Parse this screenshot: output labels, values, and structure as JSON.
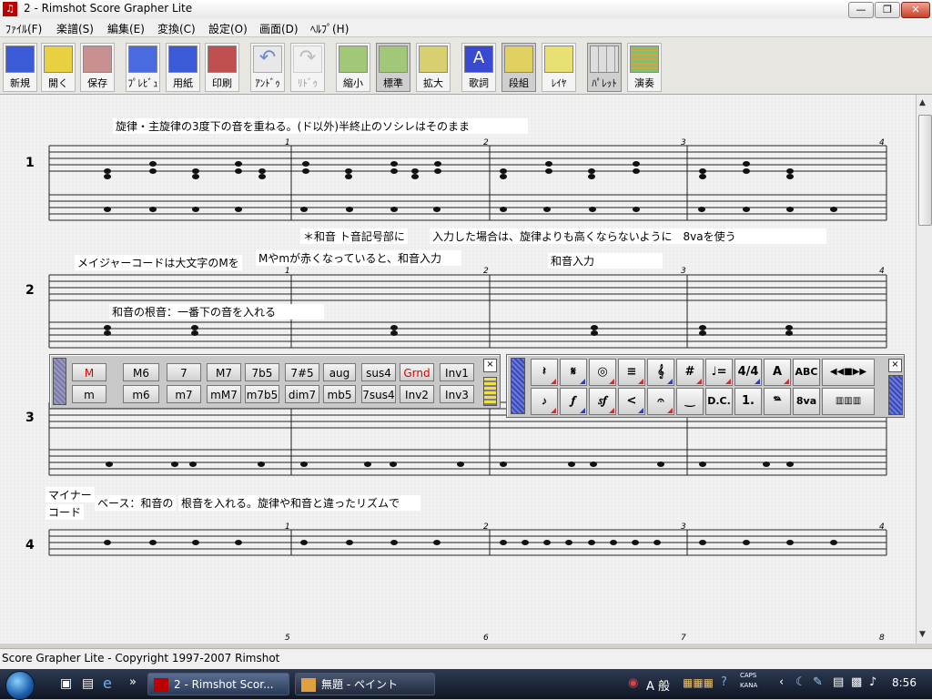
{
  "window": {
    "title": "2  - Rimshot Score Grapher Lite",
    "icon_label": "♫"
  },
  "menu": [
    "ﾌｧｲﾙ(F)",
    "楽譜(S)",
    "編集(E)",
    "変換(C)",
    "設定(O)",
    "画面(D)",
    "ﾍﾙﾌﾟ(H)"
  ],
  "toolbar": [
    {
      "label": "新規",
      "color": "#3a5ad8"
    },
    {
      "label": "開く",
      "color": "#e8d040"
    },
    {
      "label": "保存",
      "color": "#c89090"
    },
    {
      "label": "ﾌﾟﾚﾋﾞｭ",
      "color": "#4a6ae0"
    },
    {
      "label": "用紙",
      "color": "#3a5ad8"
    },
    {
      "label": "印刷",
      "color": "#c05050"
    },
    {
      "label": "ｱﾝﾄﾞｩ",
      "color": "#6a8ad0"
    },
    {
      "label": "ﾘﾄﾞｩ",
      "color": "#c8c8c8"
    },
    {
      "label": "縮小",
      "color": "#a0c878"
    },
    {
      "label": "標準",
      "color": "#a0c878"
    },
    {
      "label": "拡大",
      "color": "#d8d070"
    },
    {
      "label": "歌詞",
      "color": "#3a4ad0"
    },
    {
      "label": "段組",
      "color": "#e0d060"
    },
    {
      "label": "ﾚｲﾔ",
      "color": "#e8e070"
    },
    {
      "label": "ﾊﾟﾚｯﾄ",
      "color": "#dddddd"
    },
    {
      "label": "演奏",
      "color": "#80c070"
    }
  ],
  "systems": [
    "1",
    "2",
    "3",
    "4"
  ],
  "measure_numbers": [
    "1",
    "2",
    "3",
    "4",
    "1",
    "2",
    "3",
    "4",
    "1",
    "2",
    "3",
    "4",
    "5",
    "6",
    "7",
    "8"
  ],
  "annotations": {
    "a1": "旋律・主旋律の3度下の音を重ねる。(ド以外)半終止のソシレはそのまま",
    "a2": "＊和音 ト音記号部に",
    "a3": "入力した場合は、旋律よりも高くならないように　8vaを使う",
    "a4": "メイジャーコードは大文字のMを",
    "a5": "Mやmが赤くなっていると、和音入力",
    "a6": "和音入力",
    "a7": "和音の根音：一番下の音を入れる",
    "a8": "マイナー",
    "a9": "コード",
    "a10": "ベース：和音の",
    "a11": "根音を入れる。旋律や和音と違ったリズムで"
  },
  "chord_palette": {
    "row1": [
      "M",
      "M6",
      "7",
      "M7",
      "7b5",
      "7#5",
      "aug",
      "sus4",
      "Grnd",
      "Inv1"
    ],
    "row2": [
      "m",
      "m6",
      "m7",
      "mM7",
      "m7b5",
      "dim7",
      "mb5",
      "7sus4",
      "Inv2",
      "Inv3"
    ],
    "close": "×"
  },
  "tool_palette": {
    "row1": [
      "𝄽",
      "𝄋",
      "◎",
      "≡",
      "𝄞",
      "#",
      "♩=",
      "4/4",
      "A",
      "ABC",
      "◀◀■▶▶"
    ],
    "row2": [
      "𝆕",
      "𝆑",
      "𝆍𝆑",
      "<",
      "𝄐",
      "‿",
      "D.C.",
      "1.",
      "𝆮",
      "8va",
      "▥▥▥"
    ],
    "close": "×"
  },
  "status": "Score Grapher Lite - Copyright 1997-2007 Rimshot",
  "taskbar": {
    "tasks": [
      "2  - Rimshot Scor...",
      "無題 - ペイント"
    ],
    "tray_ime": "A 般",
    "tray_caps": "CAPS",
    "tray_kana": "KANA",
    "clock": "8:56"
  }
}
